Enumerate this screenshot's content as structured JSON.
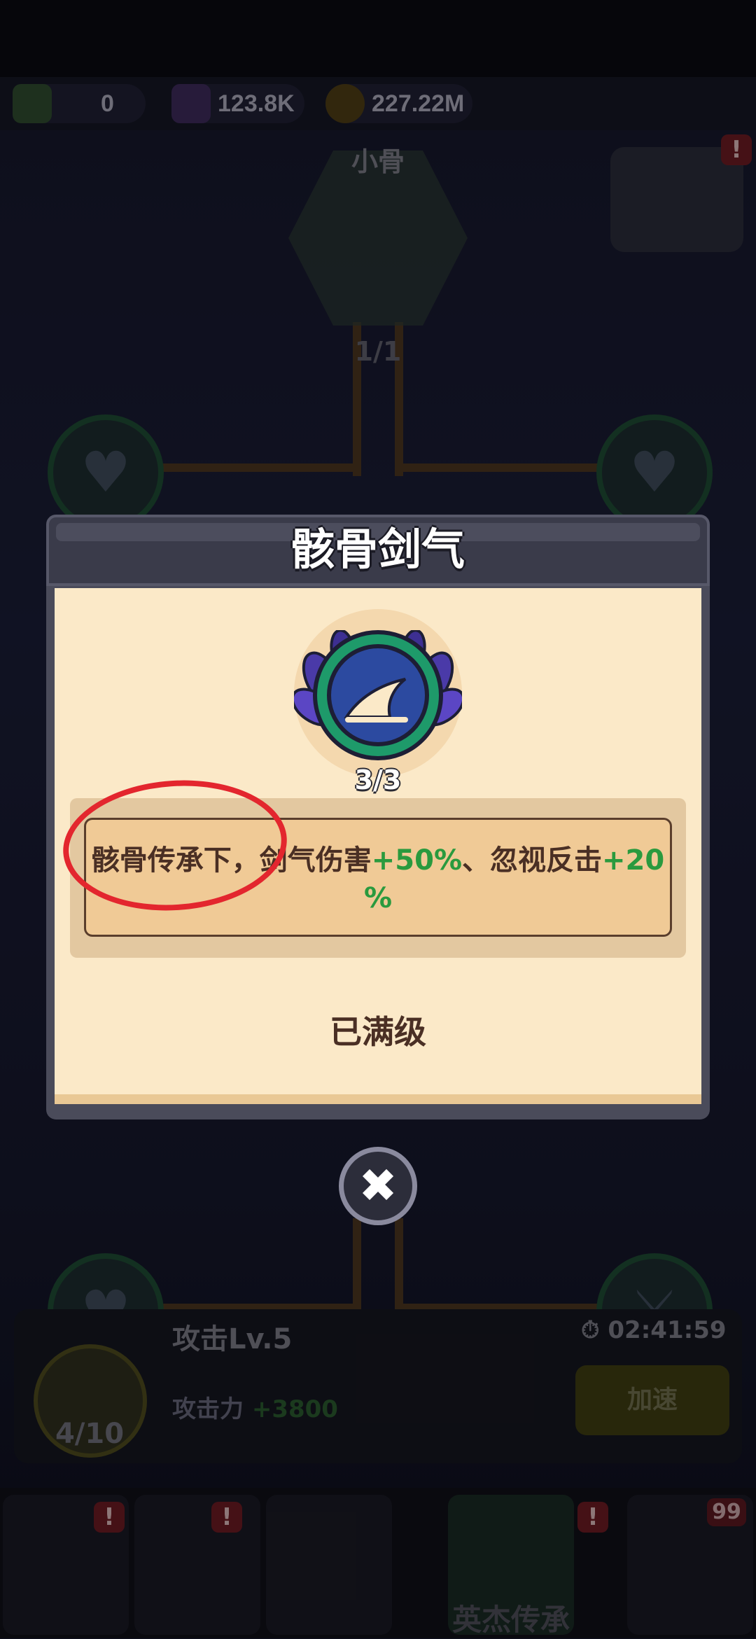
{
  "resources": [
    {
      "icon": "ticket-icon",
      "value": "0"
    },
    {
      "icon": "purple-gem-icon",
      "value": "123.8K"
    },
    {
      "icon": "gold-coin-icon",
      "value": "227.22M"
    }
  ],
  "hero": {
    "name": "小骨",
    "count": "1/1"
  },
  "alerts": {
    "mark": "!",
    "chest_badge": "99"
  },
  "dialog": {
    "title": "骸骨剑气",
    "skill_level": "3/3",
    "description": {
      "part1": "骸骨传承下，剑气伤害",
      "bonus1": "+50%",
      "part2": "、忽视反击",
      "bonus2_a": "+20",
      "bonus2_b": "%"
    },
    "status": "已满级",
    "close_symbol": "✖"
  },
  "upgrade": {
    "title": "攻击Lv.5",
    "timer": "02:41:59",
    "stat_label": "攻击力",
    "stat_bonus": "+3800",
    "count": "4/10",
    "speed_button": "加速"
  },
  "bottom_nav": {
    "active_label": "英杰传承"
  },
  "colors": {
    "dialog_body": "#fbe9c8",
    "bonus_green": "#2a9a3e",
    "highlight_red": "#e3262e"
  }
}
